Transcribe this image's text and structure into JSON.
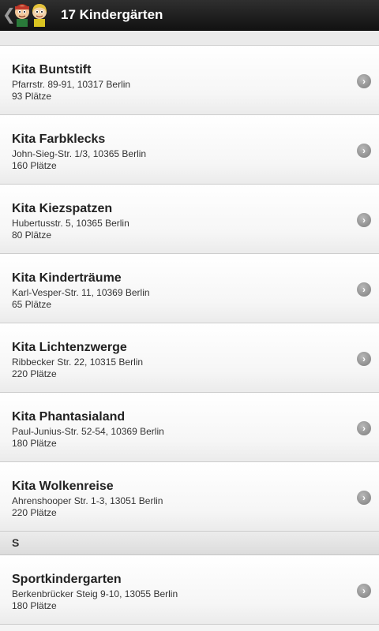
{
  "header": {
    "title": "17 Kindergärten",
    "back_icon": "chevron-left-icon",
    "app_icon": "kids-icon"
  },
  "list": {
    "items": [
      {
        "name": "Kita Buntstift",
        "address": "Pfarrstr. 89-91, 10317 Berlin",
        "places": "93 Plätze"
      },
      {
        "name": "Kita Farbklecks",
        "address": "John-Sieg-Str. 1/3, 10365 Berlin",
        "places": "160 Plätze"
      },
      {
        "name": "Kita Kiezspatzen",
        "address": "Hubertusstr. 5, 10365 Berlin",
        "places": "80 Plätze"
      },
      {
        "name": "Kita Kinderträume",
        "address": "Karl-Vesper-Str. 11, 10369 Berlin",
        "places": "65 Plätze"
      },
      {
        "name": "Kita Lichtenzwerge",
        "address": "Ribbecker Str. 22, 10315 Berlin",
        "places": "220 Plätze"
      },
      {
        "name": "Kita Phantasialand",
        "address": "Paul-Junius-Str. 52-54, 10369 Berlin",
        "places": "180 Plätze"
      },
      {
        "name": "Kita Wolkenreise",
        "address": "Ahrenshooper Str. 1-3, 13051 Berlin",
        "places": "220 Plätze"
      }
    ],
    "section_s": {
      "letter": "S",
      "items": [
        {
          "name": "Sportkindergarten",
          "address": "Berkenbrücker Steig 9-10, 13055 Berlin",
          "places": "180 Plätze"
        }
      ]
    }
  },
  "colors": {
    "topbar": "#1c1c1c",
    "disclosure": "#8c8c8c"
  }
}
